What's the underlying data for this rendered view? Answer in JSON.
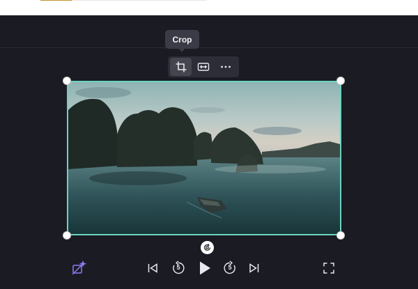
{
  "tooltip": {
    "label": "Crop"
  },
  "toolbar": {
    "items": [
      {
        "icon": "crop-icon",
        "active": true
      },
      {
        "icon": "fit-icon",
        "active": false
      },
      {
        "icon": "more-icon",
        "active": false
      }
    ]
  },
  "player": {
    "skip_back_seconds": "5",
    "skip_forward_seconds": "5",
    "controls": [
      "ai-enhance-icon",
      "skip-to-start-icon",
      "rewind-5-icon",
      "play-icon",
      "forward-5-icon",
      "skip-to-end-icon",
      "fullscreen-icon"
    ]
  },
  "colors": {
    "background": "#1b1b24",
    "selection_border": "#6ad4bf",
    "accent_purple": "#8b7cf6",
    "icon": "#e8e8ee"
  }
}
